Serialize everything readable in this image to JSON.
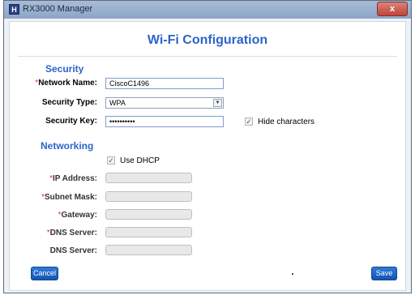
{
  "window": {
    "app_icon_letter": "H",
    "title": "RX3000 Manager",
    "close_label": "x"
  },
  "dialog": {
    "title": "Wi-Fi Configuration"
  },
  "security": {
    "heading": "Security",
    "network_name_label": "Network Name:",
    "network_name_value": "CiscoC1496",
    "security_type_label": "Security Type:",
    "security_type_value": "WPA",
    "security_key_label": "Security Key:",
    "security_key_value": "••••••••••",
    "hide_characters_label": "Hide characters",
    "hide_characters_checked": true
  },
  "networking": {
    "heading": "Networking",
    "use_dhcp_label": "Use DHCP",
    "use_dhcp_checked": true,
    "ip_address_label": "IP Address:",
    "subnet_mask_label": "Subnet Mask:",
    "gateway_label": "Gateway:",
    "dns_server_1_label": "DNS Server:",
    "dns_server_2_label": "DNS Server:"
  },
  "required_marker": "*",
  "checkmark": "✓",
  "footer": {
    "cancel_label": "Cancel",
    "save_label": "Save"
  },
  "colors": {
    "accent": "#2d64c8",
    "button": "#1f66c4",
    "required": "#e0302a"
  }
}
